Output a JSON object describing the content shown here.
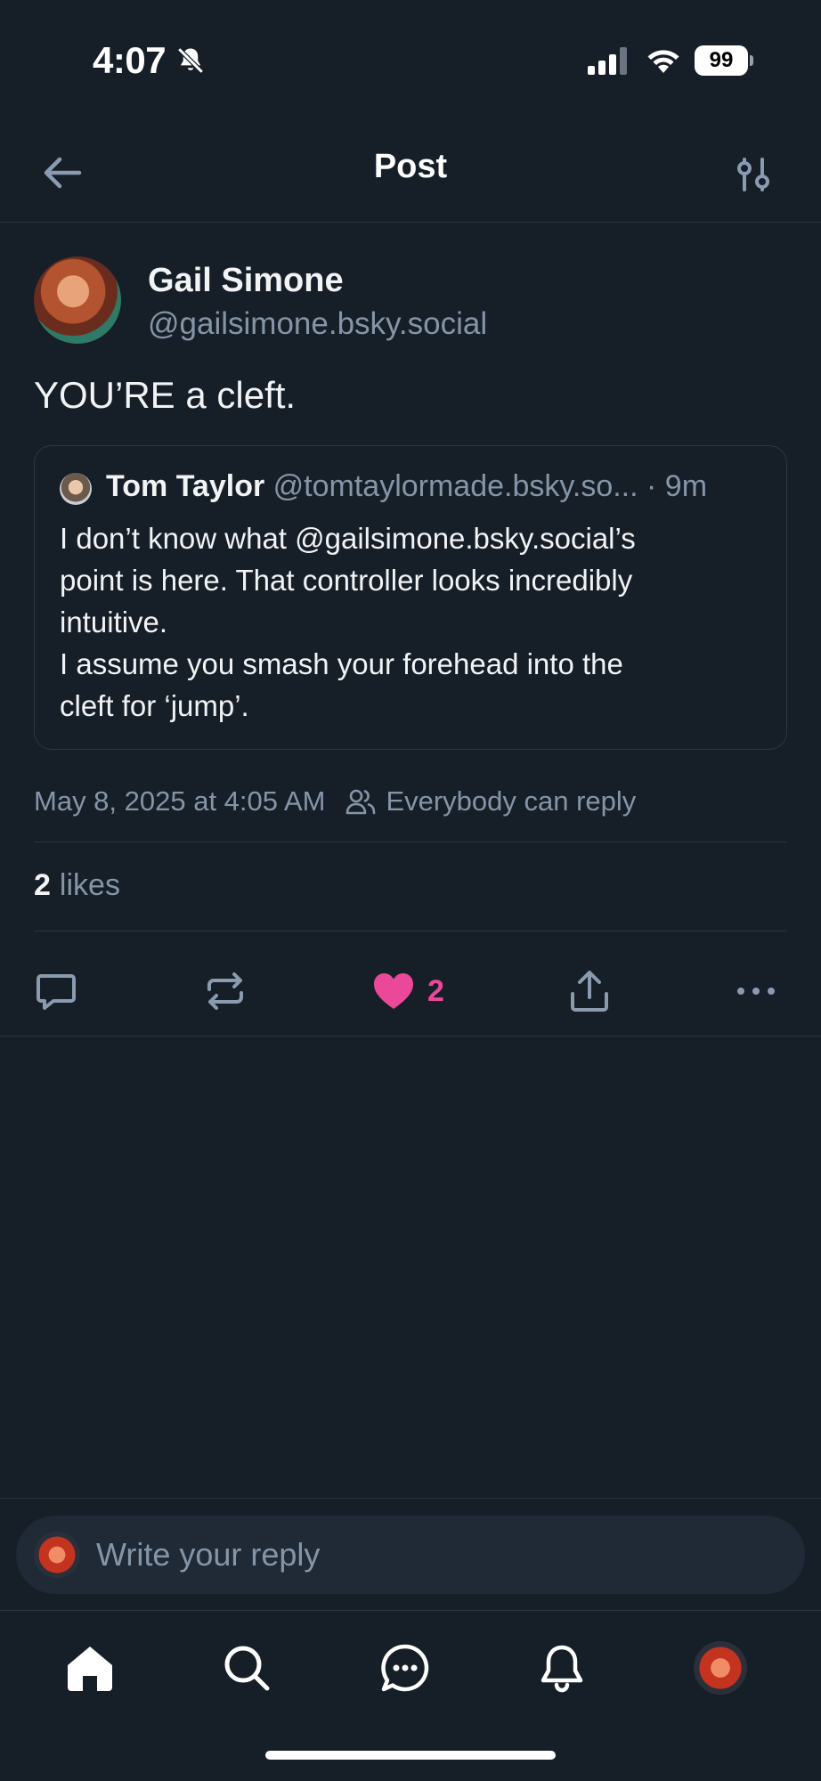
{
  "status_bar": {
    "time": "4:07",
    "battery": "99"
  },
  "header": {
    "title": "Post"
  },
  "post": {
    "author_name": "Gail Simone",
    "author_handle": "@gailsimone.bsky.social",
    "text": "YOU’RE a cleft.",
    "timestamp": "May 8, 2025 at 4:05 AM",
    "reply_setting": "Everybody can reply",
    "likes_count": "2",
    "likes_label": "likes",
    "like_action_count": "2",
    "accent_like_color": "#ec4899"
  },
  "quote": {
    "author_name": "Tom Taylor",
    "author_handle": "@tomtaylormade.bsky.so...",
    "time": "· 9m",
    "lines": [
      "I don’t know what @gailsimone.bsky.social’s",
      "point is here. That controller looks incredibly",
      "intuitive.",
      "I assume you smash your forehead into the",
      "cleft for ‘jump’."
    ]
  },
  "reply": {
    "placeholder": "Write your reply"
  },
  "icons": [
    "back-arrow-icon",
    "sliders-icon",
    "reply-icon",
    "repost-icon",
    "heart-icon",
    "share-icon",
    "more-icon",
    "home-icon",
    "search-icon",
    "chat-icon",
    "bell-icon"
  ]
}
